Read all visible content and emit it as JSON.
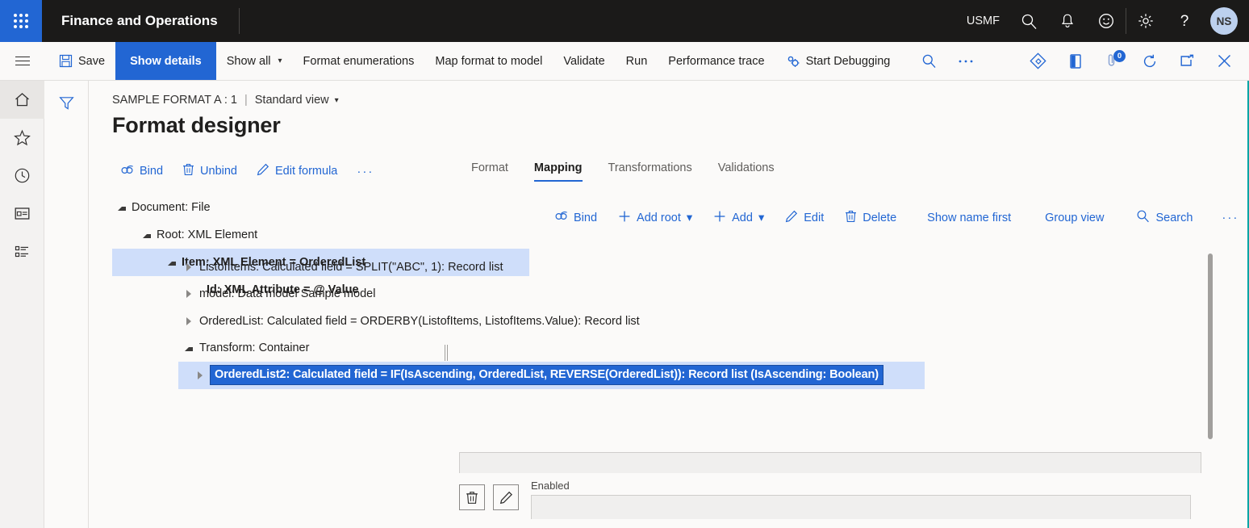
{
  "topbar": {
    "waffle_label": "app-launcher",
    "brand": "Finance and Operations",
    "company": "USMF",
    "icons": [
      {
        "name": "search-icon",
        "label": "Search"
      },
      {
        "name": "notifications-bell-icon",
        "label": "Notifications"
      },
      {
        "name": "feedback-smiley-icon",
        "label": "Feedback"
      }
    ],
    "right_icons": [
      {
        "name": "settings-gear-icon",
        "label": "Settings"
      },
      {
        "name": "help-question-icon",
        "label": "Help"
      }
    ],
    "avatar_initials": "NS"
  },
  "cmdbar": {
    "hamburger": "navigation-menu",
    "items": [
      {
        "name": "save-button",
        "label": "Save",
        "icon": "save-icon",
        "active": false,
        "caret": false
      },
      {
        "name": "show-details-button",
        "label": "Show details",
        "icon": "",
        "active": true,
        "caret": false
      },
      {
        "name": "show-all-button",
        "label": "Show all",
        "icon": "",
        "active": false,
        "caret": true
      },
      {
        "name": "format-enumerations-button",
        "label": "Format enumerations",
        "icon": "",
        "active": false,
        "caret": false
      },
      {
        "name": "map-format-to-model-button",
        "label": "Map format to model",
        "icon": "",
        "active": false,
        "caret": false
      },
      {
        "name": "validate-button",
        "label": "Validate",
        "icon": "",
        "active": false,
        "caret": false
      },
      {
        "name": "run-button",
        "label": "Run",
        "icon": "",
        "active": false,
        "caret": false
      },
      {
        "name": "performance-trace-button",
        "label": "Performance trace",
        "icon": "",
        "active": false,
        "caret": false
      },
      {
        "name": "start-debugging-button",
        "label": "Start Debugging",
        "icon": "debug-gears-icon",
        "active": false,
        "caret": false
      }
    ],
    "right_icons": [
      {
        "name": "search-icon",
        "label": "Search"
      },
      {
        "name": "overflow-menu-icon",
        "label": "More"
      },
      {
        "name": "share-diamond-icon",
        "label": "Share"
      },
      {
        "name": "office-app-icon",
        "label": "Open in Office"
      },
      {
        "name": "attachments-icon",
        "label": "Attachments",
        "badge": "0"
      },
      {
        "name": "refresh-icon",
        "label": "Refresh"
      },
      {
        "name": "popout-icon",
        "label": "Open in new window"
      },
      {
        "name": "close-icon",
        "label": "Close"
      }
    ]
  },
  "rail": {
    "items": [
      {
        "name": "sidebar-item-home",
        "label": "Home",
        "icon": "home-icon",
        "selected": true
      },
      {
        "name": "sidebar-item-favorites",
        "label": "Favorites",
        "icon": "star-icon",
        "selected": false
      },
      {
        "name": "sidebar-item-recent",
        "label": "Recent",
        "icon": "clock-icon",
        "selected": false
      },
      {
        "name": "sidebar-item-workspaces",
        "label": "Workspaces",
        "icon": "workspace-icon",
        "selected": false
      },
      {
        "name": "sidebar-item-modules",
        "label": "Modules",
        "icon": "list-icon",
        "selected": false
      }
    ],
    "filter_icon": "filter-funnel-icon"
  },
  "page": {
    "breadcrumb_text": "SAMPLE FORMAT A : 1",
    "breadcrumb_separator": "|",
    "view_selector": "Standard view",
    "title": "Format designer",
    "left_tools": [
      {
        "name": "bind-button",
        "label": "Bind",
        "icon": "link-icon"
      },
      {
        "name": "unbind-button",
        "label": "Unbind",
        "icon": "trash-icon"
      },
      {
        "name": "edit-formula-button",
        "label": "Edit formula",
        "icon": "pencil-icon"
      },
      {
        "name": "overflow-menu-button",
        "label": "···",
        "icon": ""
      }
    ]
  },
  "format_tree": [
    {
      "name": "tree-node-document",
      "label": "Document: File",
      "indent": 0,
      "expanded": true,
      "selected": false
    },
    {
      "name": "tree-node-root",
      "label": "Root: XML Element",
      "indent": 1,
      "expanded": true,
      "selected": false
    },
    {
      "name": "tree-node-item",
      "label": "Item: XML Element = OrderedList",
      "indent": 2,
      "expanded": true,
      "selected": true
    },
    {
      "name": "tree-node-id",
      "label": "Id: XML Attribute = @.Value",
      "indent": 3,
      "expanded": null,
      "selected": false
    }
  ],
  "tabs": [
    {
      "name": "tab-format",
      "label": "Format",
      "active": false
    },
    {
      "name": "tab-mapping",
      "label": "Mapping",
      "active": true
    },
    {
      "name": "tab-transformations",
      "label": "Transformations",
      "active": false
    },
    {
      "name": "tab-validations",
      "label": "Validations",
      "active": false
    }
  ],
  "mapping_tools": [
    {
      "name": "bind-button",
      "label": "Bind",
      "icon": "link-icon",
      "caret": false
    },
    {
      "name": "add-root-button",
      "label": "Add root",
      "icon": "plus-icon",
      "caret": true
    },
    {
      "name": "add-button",
      "label": "Add",
      "icon": "plus-icon",
      "caret": true
    },
    {
      "name": "edit-button",
      "label": "Edit",
      "icon": "pencil-icon",
      "caret": false
    },
    {
      "name": "delete-button",
      "label": "Delete",
      "icon": "trash-icon",
      "caret": false
    },
    {
      "name": "show-name-first-button",
      "label": "Show name first",
      "icon": "",
      "caret": false
    },
    {
      "name": "group-view-button",
      "label": "Group view",
      "icon": "",
      "caret": false
    },
    {
      "name": "search-button",
      "label": "Search",
      "icon": "search-icon",
      "caret": false
    },
    {
      "name": "mapping-overflow-button",
      "label": "···",
      "icon": "",
      "caret": false
    }
  ],
  "data_tree": [
    {
      "name": "data-row-listofitems",
      "label": "ListofItems: Calculated field = SPLIT(\"ABC\", 1): Record list",
      "indent": 0,
      "expanded": false,
      "selected": false
    },
    {
      "name": "data-row-model",
      "label": "model: Data model Sample model",
      "indent": 0,
      "expanded": false,
      "selected": false
    },
    {
      "name": "data-row-orderedlist",
      "label": "OrderedList: Calculated field = ORDERBY(ListofItems, ListofItems.Value): Record list",
      "indent": 0,
      "expanded": false,
      "selected": false
    },
    {
      "name": "data-row-transform",
      "label": "Transform: Container",
      "indent": 0,
      "expanded": true,
      "selected": false
    },
    {
      "name": "data-row-orderedlist2",
      "label": "OrderedList2: Calculated field = IF(IsAscending, OrderedList, REVERSE(OrderedList)): Record list (IsAscending: Boolean)",
      "indent": 1,
      "expanded": false,
      "selected": true
    }
  ],
  "detail": {
    "delete_button": {
      "name": "delete-row-button",
      "icon": "trash-icon"
    },
    "edit_button": {
      "name": "edit-row-button",
      "icon": "pencil-icon"
    },
    "enabled_label": "Enabled",
    "enabled_value": "",
    "formula_value": ""
  },
  "colors": {
    "accent_blue": "#2266d3",
    "selection_blue": "#cfdefa",
    "topbar_black": "#1b1a19",
    "window_accent_teal": "#06a5a5"
  }
}
